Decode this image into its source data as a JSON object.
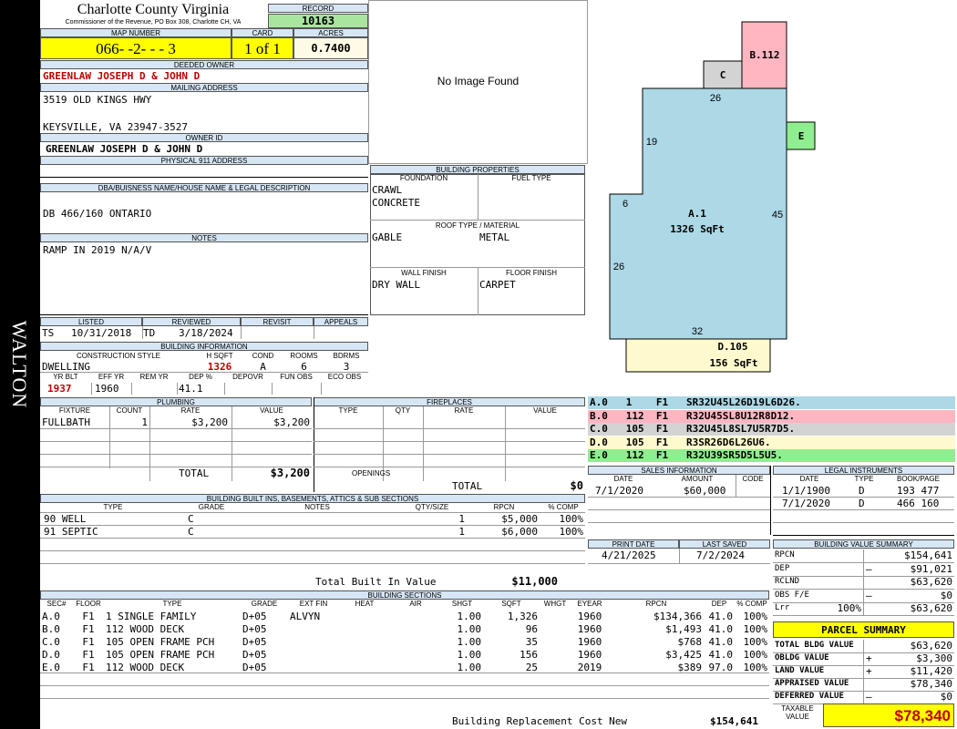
{
  "side_label": "WALTON",
  "county": {
    "name": "Charlotte County Virginia",
    "commissioner": "Commissioner of the Revenue, PO Box 308, Charlotte CH, VA"
  },
  "record": {
    "label": "RECORD",
    "value": "10163"
  },
  "map": {
    "label": "MAP NUMBER",
    "value": "066- -2- - - 3",
    "card_label": "CARD",
    "card": "1 of 1",
    "acres_label": "ACRES",
    "acres": "0.7400"
  },
  "owner": {
    "deeded_label": "DEEDED OWNER",
    "deeded": "GREENLAW JOSEPH D & JOHN D",
    "mailing_label": "MAILING ADDRESS",
    "addr1": "3519 OLD KINGS HWY",
    "addr2": "KEYSVILLE, VA 23947-3527",
    "owner_id_label": "OWNER ID",
    "owner_id": "GREENLAW JOSEPH D & JOHN D",
    "physical_label": "PHYSICAL 911 ADDRESS"
  },
  "dba": {
    "label": "DBA/BUISNESS NAME/HOUSE NAME & LEGAL DESCRIPTION",
    "value": "DB 466/160 ONTARIO"
  },
  "notes": {
    "label": "NOTES",
    "value": "RAMP IN 2019 N/A/V"
  },
  "image": {
    "text": "No Image Found"
  },
  "building_props": {
    "title": "BUILDING PROPERTIES",
    "foundation_label": "FOUNDATION",
    "fuel_label": "FUEL TYPE",
    "foundation1": "CRAWL",
    "foundation2": "CONCRETE",
    "roof_label": "ROOF TYPE / MATERIAL",
    "roof_type": "GABLE",
    "roof_mat": "METAL",
    "wall_label": "WALL FINISH",
    "floor_label": "FLOOR FINISH",
    "wall": "DRY WALL",
    "floor": "CARPET"
  },
  "listed": {
    "listed_label": "LISTED",
    "reviewed_label": "REVIEWED",
    "revisit_label": "REVISIT",
    "appeals_label": "APPEALS",
    "listed_by": "TS",
    "listed_date": "10/31/2018",
    "reviewed_by": "TD",
    "reviewed_date": "3/18/2024"
  },
  "building_info": {
    "title": "BUILDING INFORMATION",
    "style_label": "CONSTRUCTION STYLE",
    "hsqft_label": "H SQFT",
    "cond_label": "COND",
    "rooms_label": "ROOMS",
    "bdrms_label": "BDRMS",
    "style": "DWELLING",
    "hsqft": "1326",
    "cond": "A",
    "rooms": "6",
    "bdrms": "3",
    "yrblt_label": "YR BLT",
    "effyr_label": "EFF YR",
    "remyr_label": "REM YR",
    "dep_label": "DEP %",
    "depovr_label": "DEPOVR",
    "funobs_label": "FUN OBS",
    "ecoobs_label": "ECO OBS",
    "yrblt": "1937",
    "effyr": "1960",
    "dep": "41.1"
  },
  "plumbing": {
    "title": "PLUMBING",
    "h_fixture": "FIXTURE",
    "h_count": "COUNT",
    "h_rate": "RATE",
    "h_value": "VALUE",
    "rows": [
      {
        "fixture": "FULLBATH",
        "count": "1",
        "rate": "$3,200",
        "value": "$3,200"
      }
    ],
    "total_label": "TOTAL",
    "total": "$3,200"
  },
  "fireplaces": {
    "title": "FIREPLACES",
    "h_type": "TYPE",
    "h_qty": "QTY",
    "h_rate": "RATE",
    "h_value": "VALUE",
    "openings_label": "OPENINGS",
    "total_label": "TOTAL",
    "total": "$0"
  },
  "built_ins": {
    "title": "BUILDING BUILT INS, BASEMENTS, ATTICS & SUB SECTIONS",
    "h_type": "TYPE",
    "h_grade": "GRADE",
    "h_notes": "NOTES",
    "h_qty": "QTY/SIZE",
    "h_rpcn": "RPCN",
    "h_comp": "% COMP",
    "rows": [
      {
        "type": "90 WELL",
        "grade": "C",
        "qty": "1",
        "rpcn": "$5,000",
        "comp": "100%"
      },
      {
        "type": "91 SEPTIC",
        "grade": "C",
        "qty": "1",
        "rpcn": "$6,000",
        "comp": "100%"
      }
    ],
    "total_label": "Total Built In Value",
    "total": "$11,000"
  },
  "sections": {
    "title": "BUILDING SECTIONS",
    "h": [
      "SEC#",
      "FLOOR",
      "TYPE",
      "GRADE",
      "EXT FIN",
      "HEAT",
      "AIR",
      "SHGT",
      "SQFT",
      "WHGT",
      "EYEAR",
      "RPCN",
      "DEP",
      "% COMP"
    ],
    "rows": [
      {
        "sec": "A.0",
        "floor": "F1",
        "type": "1 SINGLE FAMILY",
        "grade": "D+05",
        "ext": "ALVYN",
        "shgt": "1.00",
        "sqft": "1,326",
        "eyear": "1960",
        "rpcn": "$134,366",
        "dep": "41.0",
        "comp": "100%"
      },
      {
        "sec": "B.0",
        "floor": "F1",
        "type": "112 WOOD DECK",
        "grade": "D+05",
        "ext": "",
        "shgt": "1.00",
        "sqft": "96",
        "eyear": "1960",
        "rpcn": "$1,493",
        "dep": "41.0",
        "comp": "100%"
      },
      {
        "sec": "C.0",
        "floor": "F1",
        "type": "105 OPEN FRAME PCH",
        "grade": "D+05",
        "ext": "",
        "shgt": "1.00",
        "sqft": "35",
        "eyear": "1960",
        "rpcn": "$768",
        "dep": "41.0",
        "comp": "100%"
      },
      {
        "sec": "D.0",
        "floor": "F1",
        "type": "105 OPEN FRAME PCH",
        "grade": "D+05",
        "ext": "",
        "shgt": "1.00",
        "sqft": "156",
        "eyear": "1960",
        "rpcn": "$3,425",
        "dep": "41.0",
        "comp": "100%"
      },
      {
        "sec": "E.0",
        "floor": "F1",
        "type": "112 WOOD DECK",
        "grade": "D+05",
        "ext": "",
        "shgt": "1.00",
        "sqft": "25",
        "eyear": "2019",
        "rpcn": "$389",
        "dep": "97.0",
        "comp": "100%"
      }
    ],
    "total_label": "Building Replacement Cost New",
    "total": "$154,641"
  },
  "sketch": {
    "a_label": "A.1",
    "a_area": "1326 SqFt",
    "b_label": "B.112",
    "c_label": "C",
    "d_label": "D.105",
    "d_area": "156 SqFt",
    "e_label": "E",
    "dims": [
      "26",
      "19",
      "6",
      "45",
      "26",
      "32"
    ],
    "colors": {
      "a": "#add8e6",
      "b": "#ffb6c1",
      "c": "#d3d3d3",
      "d": "#fffacd",
      "e": "#90ee90"
    }
  },
  "legend": [
    {
      "text": "A.0   1    F1   SR32U45L26D19L6D26.",
      "color": "#add8e6"
    },
    {
      "text": "B.0   112  F1   R32U45SL8U12R8D12.",
      "color": "#ffb6c1"
    },
    {
      "text": "C.0   105  F1   R32U45L8SL7U5R7D5.",
      "color": "#d3d3d3"
    },
    {
      "text": "D.0   105  F1   R3SR26D6L26U6.",
      "color": "#fffacd"
    },
    {
      "text": "E.0   112  F1   R32U39SR5D5L5U5.",
      "color": "#90ee90"
    }
  ],
  "sales": {
    "title": "SALES INFORMATION",
    "h_date": "DATE",
    "h_amount": "AMOUNT",
    "h_code": "CODE",
    "rows": [
      {
        "date": "7/1/2020",
        "amount": "$60,000"
      }
    ]
  },
  "legal": {
    "title": "LEGAL INSTRUMENTS",
    "h_date": "DATE",
    "h_type": "TYPE",
    "h_book": "BOOK/PAGE",
    "rows": [
      {
        "date": "1/1/1900",
        "type": "D",
        "book": "193 477"
      },
      {
        "date": "7/1/2020",
        "type": "D",
        "book": "466 160"
      }
    ]
  },
  "print": {
    "print_label": "PRINT DATE",
    "saved_label": "LAST SAVED",
    "print_date": "4/21/2025",
    "saved_date": "7/2/2024"
  },
  "value_summary": {
    "title": "BUILDING VALUE SUMMARY",
    "rows": [
      {
        "label": "RPCN",
        "sign": "",
        "pct": "",
        "value": "$154,641"
      },
      {
        "label": "DEP",
        "sign": "–",
        "pct": "",
        "value": "$91,021"
      },
      {
        "label": "RCLND",
        "sign": "",
        "pct": "",
        "value": "$63,620"
      },
      {
        "label": "OBS F/E",
        "sign": "–",
        "pct": "",
        "value": "$0"
      },
      {
        "label": "Lrr",
        "sign": "",
        "pct": "100%",
        "value": "$63,620"
      }
    ]
  },
  "parcel": {
    "title": "PARCEL SUMMARY",
    "rows": [
      {
        "label": "TOTAL BLDG VALUE",
        "sign": "",
        "value": "$63,620"
      },
      {
        "label": "OBLDG VALUE",
        "sign": "+",
        "value": "$3,300"
      },
      {
        "label": "LAND VALUE",
        "sign": "+",
        "value": "$11,420"
      },
      {
        "label": "APPRAISED VALUE",
        "sign": "",
        "value": "$78,340"
      },
      {
        "label": "DEFERRED VALUE",
        "sign": "–",
        "value": "$0"
      }
    ],
    "taxable_label": "TAXABLE VALUE",
    "taxable": "$78,340"
  }
}
